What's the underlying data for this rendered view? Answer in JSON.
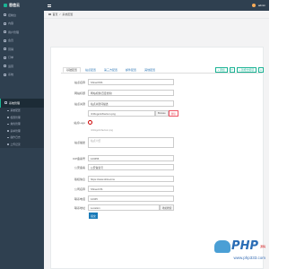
{
  "app": {
    "brand": "思信云"
  },
  "topbar": {
    "user": "admin"
  },
  "sidebar": {
    "items": [
      {
        "label": "控制台"
      },
      {
        "label": "内容"
      },
      {
        "label": "用户管理"
      },
      {
        "label": "会员"
      },
      {
        "label": "营销"
      },
      {
        "label": "订单"
      },
      {
        "label": "运营"
      },
      {
        "label": "系统"
      },
      {
        "label": "系统管理"
      }
    ],
    "subitems": [
      {
        "label": "系统配置"
      },
      {
        "label": "权限管理"
      },
      {
        "label": "角色管理"
      },
      {
        "label": "菜单管理"
      },
      {
        "label": "操作日志"
      },
      {
        "label": "上传记录"
      }
    ]
  },
  "breadcrumb": {
    "home": "首页",
    "current": "系统配置"
  },
  "tabs": [
    {
      "label": "基础配置"
    },
    {
      "label": "站点配置"
    },
    {
      "label": "第三方配置"
    },
    {
      "label": "邮件配置"
    },
    {
      "label": "其他配置"
    }
  ],
  "toolbar": {
    "add_label": "+ 添加",
    "add_group_label": "+ 新增分组项"
  },
  "form": {
    "site_name": {
      "label": "站点名称",
      "value": "ShineCMS"
    },
    "site_title": {
      "label": "网站标题",
      "value": "网站标题(百度搜索)"
    },
    "site_keywords": {
      "label": "站点关键",
      "value": "站点关键词描述"
    },
    "site_logo": {
      "label": "站点Logo",
      "file": "/13/logo/ic/favicon.png",
      "browse": "Browse",
      "delete": "删除",
      "hint": "/13/logo/ic/favicon.png"
    },
    "site_desc": {
      "label": "站点描述",
      "placeholder": "站点介绍"
    },
    "icp": {
      "label": "ICP备案号",
      "value": "123456"
    },
    "police": {
      "label": "公安备案",
      "value": "公安备案号"
    },
    "copyright": {
      "label": "版权信息",
      "value": "https://www.shinecms"
    },
    "company": {
      "label": "公司名称",
      "value": "Shined.NS"
    },
    "phone": {
      "label": "联系电话",
      "value": "12345"
    },
    "address": {
      "label": "联系地址",
      "value": "Location",
      "btn": "地址检索"
    },
    "submit": "提交"
  },
  "watermark": {
    "text": "PHP",
    "cn": "源码",
    "url": "www.php333.com"
  }
}
